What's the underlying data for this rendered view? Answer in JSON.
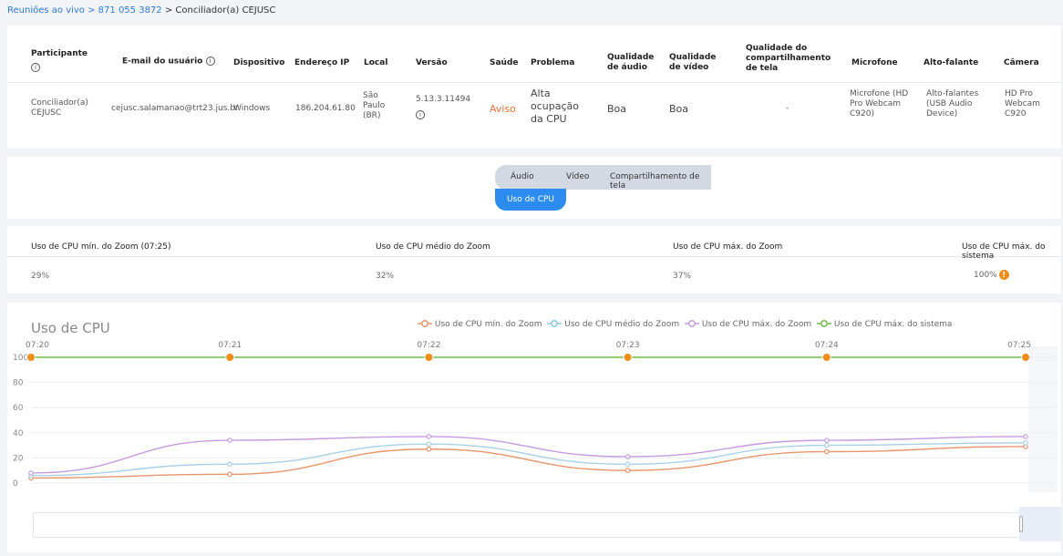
{
  "breadcrumb": {
    "link": "Reuniões ao vivo",
    "sep1": " > ",
    "meeting_id": "871 055 3872",
    "sep2": " > ",
    "current": "Conciliador(a) CEJUSC"
  },
  "table": {
    "headers": {
      "participant": "Participante",
      "email": "E-mail do usuário",
      "device": "Dispositivo",
      "ip": "Endereço IP",
      "location": "Local",
      "version": "Versão",
      "health": "Saúde",
      "problem": "Problema",
      "audio_quality": "Qualidade de áudio",
      "video_quality": "Qualidade de vídeo",
      "share_quality": "Qualidade do compartilhamento de tela",
      "microphone": "Microfone",
      "speaker": "Alto-falante",
      "camera": "Câmera"
    },
    "row": {
      "participant": "Conciliador(a) CEJUSC",
      "email": "cejusc.salamanao@trt23.jus.br",
      "device": "Windows",
      "ip": "186.204.61.80",
      "location": "São Paulo (BR)",
      "version": "5.13.3.11494",
      "health": "Aviso",
      "problem": "Alta ocupação da CPU",
      "audio_quality": "Boa",
      "video_quality": "Boa",
      "share_quality": "-",
      "microphone": "Microfone (HD Pro Webcam C920)",
      "speaker": "Alto-falantes (USB Audio Device)",
      "camera": "HD Pro Webcam C920"
    }
  },
  "tabs": {
    "audio": "Áudio",
    "video": "Vídeo",
    "share": "Compartilhamento de tela",
    "cpu": "Uso de CPU"
  },
  "stats": {
    "min_label": "Uso de CPU mín. do Zoom (07:25)",
    "min_value": "29%",
    "avg_label": "Uso de CPU médio do Zoom",
    "avg_value": "32%",
    "max_label": "Uso de CPU máx. do Zoom",
    "max_value": "37%",
    "sys_label": "Uso de CPU máx. do sistema",
    "sys_value": "100%",
    "warn_glyph": "!"
  },
  "colors": {
    "accent": "#2d8cf0",
    "warning": "#f08c1a",
    "min": "#e8956a",
    "avg": "#a8d0e6",
    "max": "#c79be0",
    "sys": "#6cbf48"
  },
  "chart_data": {
    "type": "line",
    "title": "Uso de CPU",
    "x": [
      "07:20",
      "07:21",
      "07:22",
      "07:23",
      "07:24",
      "07:25"
    ],
    "y_ticks": [
      100,
      80,
      60,
      40,
      20,
      0
    ],
    "ylim": [
      0,
      100
    ],
    "legend_position": "top",
    "series": [
      {
        "name": "Uso de CPU mín. do Zoom",
        "values": [
          4,
          7,
          27,
          10,
          25,
          29
        ]
      },
      {
        "name": "Uso de CPU médio do Zoom",
        "values": [
          6,
          15,
          31,
          15,
          30,
          32
        ]
      },
      {
        "name": "Uso de CPU máx. do Zoom",
        "values": [
          8,
          34,
          37,
          21,
          34,
          37
        ]
      },
      {
        "name": "Uso de CPU máx. do sistema",
        "values": [
          100,
          100,
          100,
          100,
          100,
          100
        ]
      }
    ]
  }
}
